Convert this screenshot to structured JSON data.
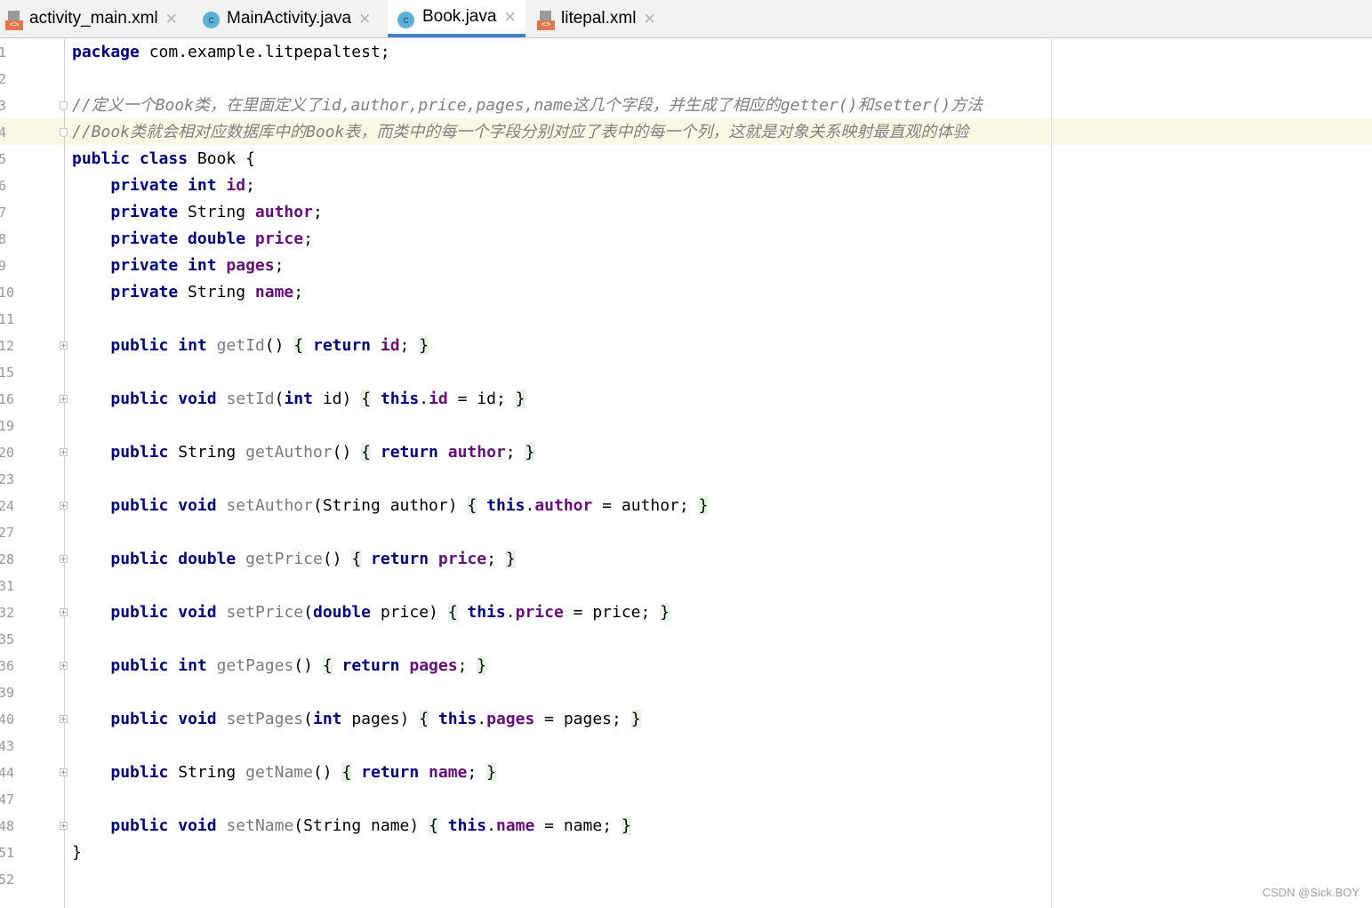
{
  "tabs": [
    {
      "label": "activity_main.xml",
      "icon": "xml-file-icon",
      "active": false
    },
    {
      "label": "MainActivity.java",
      "icon": "java-class-icon",
      "active": false
    },
    {
      "label": "Book.java",
      "icon": "java-class-icon",
      "active": true
    },
    {
      "label": "litepal.xml",
      "icon": "xml-file-icon",
      "active": false
    }
  ],
  "tab_close_glyph": "×",
  "xml_icon_text": "<>",
  "class_icon_text": "c",
  "line_numbers": [
    "1",
    "2",
    "3",
    "4",
    "5",
    "6",
    "7",
    "8",
    "9",
    "10",
    "11",
    "12",
    "15",
    "16",
    "19",
    "20",
    "23",
    "24",
    "27",
    "28",
    "31",
    "32",
    "35",
    "36",
    "39",
    "40",
    "43",
    "44",
    "47",
    "48",
    "51",
    "52"
  ],
  "code": {
    "l1_kw": "package",
    "l1_rest": " com.example.litpepaltest;",
    "l3_comment": "//定义一个Book类，在里面定义了id,author,price,pages,name这几个字段，并生成了相应的getter()和setter()方法",
    "l4_comment": "//Book类就会相对应数据库中的Book表，而类中的每一个字段分别对应了表中的每一个列，这就是对象关系映射最直观的体验",
    "l5_kw": "public class",
    "l5_rest": " Book {",
    "fields": [
      {
        "mods": "private int",
        "type": "",
        "name": "id"
      },
      {
        "mods": "private",
        "type": " String",
        "name": "author"
      },
      {
        "mods": "private double",
        "type": "",
        "name": "price"
      },
      {
        "mods": "private int",
        "type": "",
        "name": "pages"
      },
      {
        "mods": "private",
        "type": " String",
        "name": "name"
      }
    ],
    "kw_public": "public",
    "kw_int": "int",
    "kw_void": "void",
    "kw_double": "double",
    "kw_return": "return",
    "kw_this": "this",
    "type_string": "String",
    "m_getId": "getId",
    "m_setId": "setId",
    "m_getAuthor": "getAuthor",
    "m_setAuthor": "setAuthor",
    "m_getPrice": "getPrice",
    "m_setPrice": "setPrice",
    "m_getPages": "getPages",
    "m_setPages": "setPages",
    "m_getName": "getName",
    "m_setName": "setName",
    "p_id": "id",
    "p_author": "author",
    "p_price": "price",
    "p_pages": "pages",
    "p_name": "name",
    "close_brace": "}"
  },
  "watermark": "CSDN @Sick.BOY"
}
